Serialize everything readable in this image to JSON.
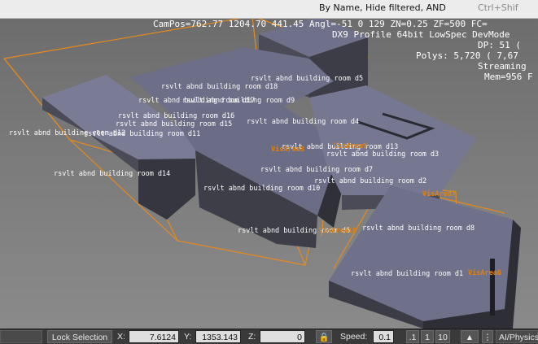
{
  "filter_bar": {
    "text": "By Name, Hide filtered, AND",
    "shortcut": "Ctrl+Shif"
  },
  "hud": {
    "line1": "CamPos=762.77 1204.70 441.45 Angl=-51  0 129 ZN=0.25 ZF=500 FC=",
    "line2": "DX9 Profile 64bit LowSpec DevMode",
    "line3": "DP:  51 (",
    "line4": "Polys:  5,720 ( 7,67",
    "line5": "Streaming",
    "line6": "Mem=956 F"
  },
  "room_labels": [
    "rsvlt abnd building room d5",
    "rsvlt abnd building room d18",
    "rsvlt abnd building room d17",
    "rsvlt abnd building room d9",
    "rsvlt abnd building room d16",
    "rsvlt abnd building room d15",
    "rsvlt abnd building room d11",
    "rsvlt abnd building room d12",
    "rsvlt abnd building room d4",
    "rsvlt abnd building room d13",
    "rsvlt abnd building room d3",
    "rsvlt abnd building room d7",
    "rsvlt abnd building room d14",
    "rsvlt abnd building room d2",
    "rsvlt abnd building room d10",
    "rsvlt abnd building room d6",
    "rsvlt abnd building room d8",
    "rsvlt abnd building room d1"
  ],
  "vis_labels": [
    "VisArea8",
    "VisArea9",
    "VisArea7",
    "VisArea10",
    "VisArea6"
  ],
  "status_bar": {
    "lock_selection": "Lock Selection",
    "x_label": "X:",
    "x_value": "7.6124",
    "y_label": "Y:",
    "y_value": "1353.143",
    "z_label": "Z:",
    "z_value": "0",
    "speed_label": "Speed:",
    "speed_value": "0.1",
    "speed_opts": [
      ".1",
      "1",
      "10"
    ],
    "mode": "AI/Physics"
  },
  "colors": {
    "visarea_outline": "#e8891a",
    "building_top": "#6e6f8a",
    "building_side": "#3b3c45",
    "label_text": "#ffffff"
  }
}
